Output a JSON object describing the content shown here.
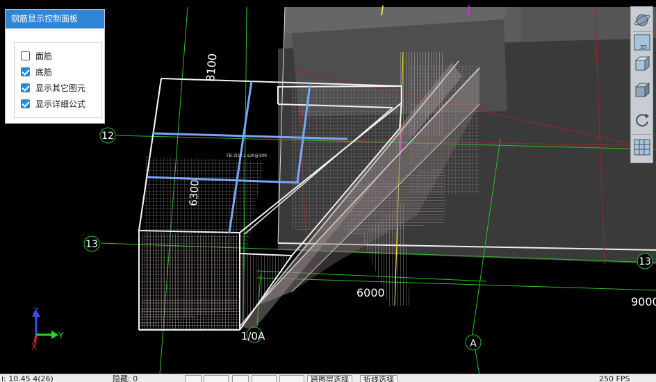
{
  "panel": {
    "title": "钢筋显示控制面板",
    "options": [
      {
        "label": "面筋",
        "checked": false
      },
      {
        "label": "底筋",
        "checked": true
      },
      {
        "label": "显示其它图元",
        "checked": true
      },
      {
        "label": "显示详细公式",
        "checked": true
      }
    ]
  },
  "scene": {
    "axis_12": "12",
    "axis_13_left": "13",
    "axis_13_right": "13",
    "axis_1_0A": "1/0A",
    "axis_A": "A",
    "dim_8100": "8100",
    "dim_6300": "6300",
    "dim_6000": "6000",
    "dim_9000": "9000"
  },
  "coord_axes": {
    "z": "Z",
    "y": "Y",
    "x": "X"
  },
  "toolbar": {
    "icons": [
      "orbit-icon",
      "view-2d-icon",
      "view-3d-icon",
      "cube-icon",
      "rotate-icon",
      "grid-settings-icon"
    ],
    "badge_2d": "2D"
  },
  "statusbar": {
    "coords": "i: 10.45   4(26)",
    "hidden": "隐藏: 0",
    "layer_select": "跨图层选择",
    "polyline_select": "折线选择",
    "fps": "250 FPS"
  },
  "colors": {
    "panel_header": "#2f86d6",
    "axis_line": "#2bbf2b",
    "rebar": "#b8a8a8",
    "highlight_blue": "#7aa6ff"
  }
}
